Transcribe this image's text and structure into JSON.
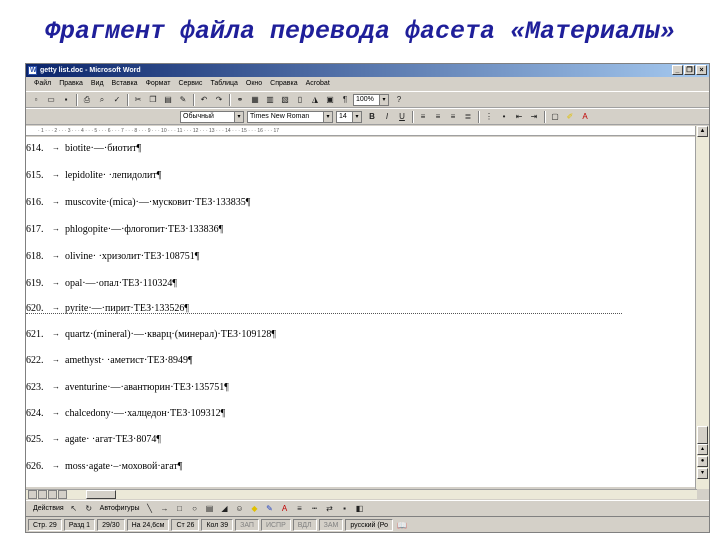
{
  "slide": {
    "title": "Фрагмент файла перевода фасета «Материалы»"
  },
  "window": {
    "title": "getty list.doc - Microsoft Word",
    "buttons": {
      "minimize": "_",
      "restore": "❐",
      "close": "×"
    }
  },
  "menu": [
    "Файл",
    "Правка",
    "Вид",
    "Вставка",
    "Формат",
    "Сервис",
    "Таблица",
    "Окно",
    "Справка",
    "Acrobat"
  ],
  "toolbar": {
    "zoom": "100%",
    "style": "Обычный",
    "font": "Times New Roman",
    "size": "14"
  },
  "document": {
    "entries": [
      {
        "num": "614.",
        "text": "biotite·—·биотит¶"
      },
      {
        "num": "615.",
        "text": "lepidolite· ·лепидолит¶"
      },
      {
        "num": "616.",
        "text": "muscovite·(mica)·—·мусковит·ТЕЗ·133835¶"
      },
      {
        "num": "617.",
        "text": "phlogopite·—·флогопит·ТЕЗ·133836¶"
      },
      {
        "num": "618.",
        "text": "olivine· ·хризолит·ТЕЗ·108751¶"
      },
      {
        "num": "619.",
        "text": "opal·—·опал·ТЕЗ·110324¶"
      },
      {
        "num": "620.",
        "text": "pyrite·—·пирит·ТЕЗ·133526¶"
      },
      {
        "num": "621.",
        "text": "quartz·(mineral)·—·кварц·(минерал)·ТЕЗ·109128¶"
      },
      {
        "num": "622.",
        "text": "amethyst· ·аметист·ТЕЗ·8949¶"
      },
      {
        "num": "623.",
        "text": "aventurine·—·авантюрин·ТЕЗ·135751¶"
      },
      {
        "num": "624.",
        "text": "chalcedony·—·халцедон·ТЕЗ·109312¶"
      },
      {
        "num": "625.",
        "text": "agate· ·агат·ТЕЗ·8074¶"
      },
      {
        "num": "626.",
        "text": "moss·agate·–·моховой·агат¶"
      }
    ]
  },
  "drawing": {
    "actions_label": "Действия",
    "autoshapes_label": "Автофигуры"
  },
  "status": {
    "page": "Стр. 29",
    "section": "Разд 1",
    "pages": "29/30",
    "at": "На 24,6см",
    "line": "Ст 26",
    "col": "Кол 39",
    "rec": "ЗАП",
    "trk": "ИСПР",
    "ext": "ВДЛ",
    "ovr": "ЗАМ",
    "language": "русский (Ро"
  }
}
